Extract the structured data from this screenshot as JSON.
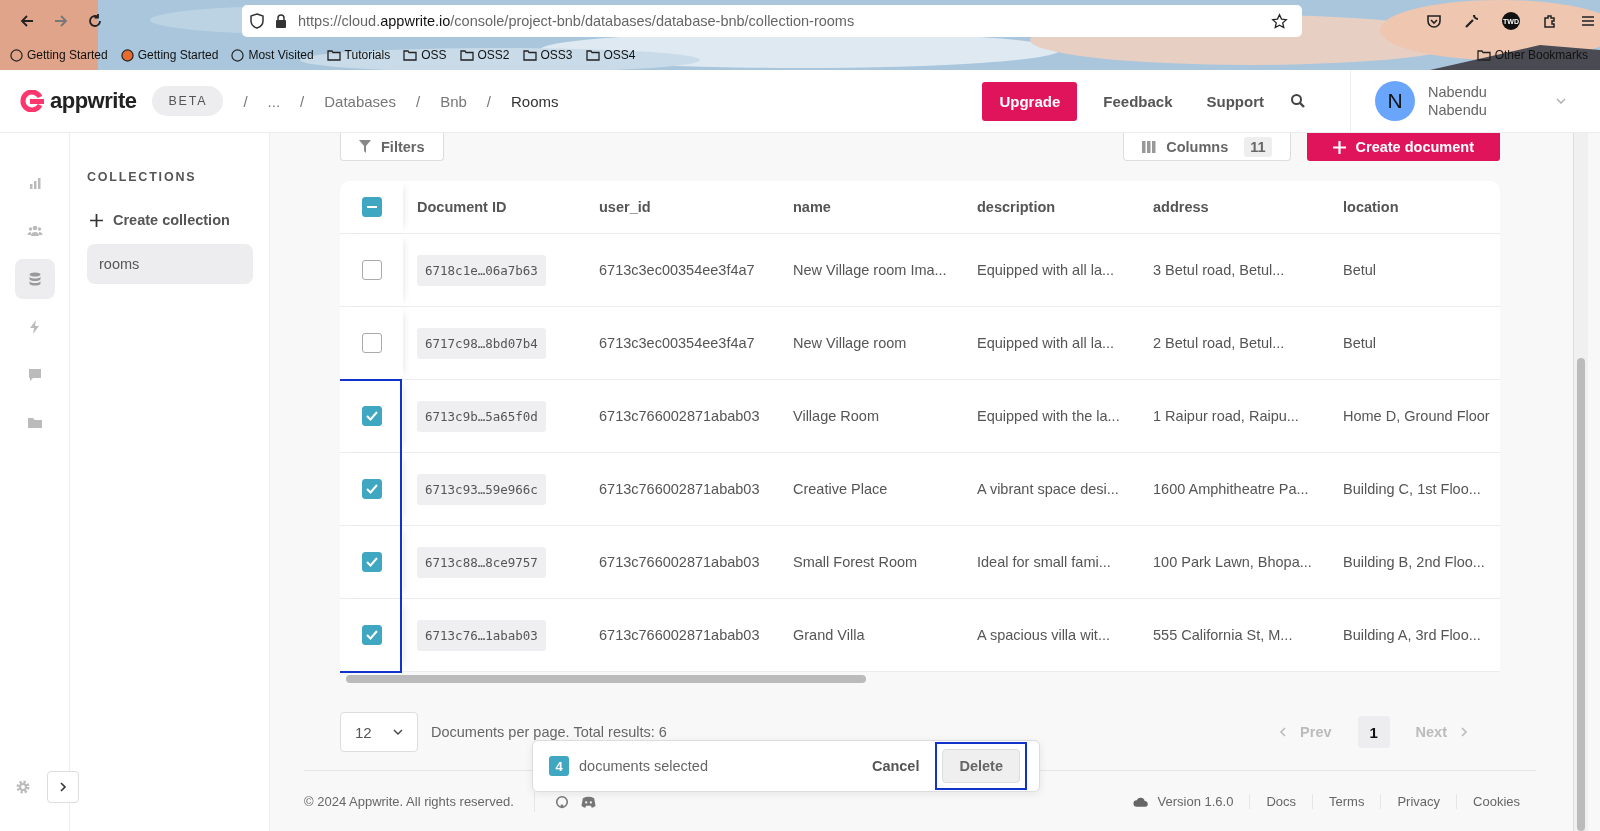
{
  "browser": {
    "url_host": "https://cloud.",
    "url_domain": "appwrite.io",
    "url_path": "/console/project-bnb/databases/database-bnb/collection-rooms",
    "profile": "TWD",
    "bookmarks": [
      "Getting Started",
      "Getting Started",
      "Most Visited",
      "Tutorials",
      "OSS",
      "OSS2",
      "OSS3",
      "OSS4"
    ],
    "other_bookmarks": "Other Bookmarks"
  },
  "header": {
    "logo": "appwrite",
    "badge": "BETA",
    "breadcrumbs": [
      "...",
      "Databases",
      "Bnb",
      "Rooms"
    ],
    "separator": "/",
    "upgrade": "Upgrade",
    "links": [
      "Feedback",
      "Support"
    ],
    "user": {
      "initial": "N",
      "name": "Nabendu",
      "email": "Nabendu"
    }
  },
  "rail": [
    {
      "kind": "chart",
      "selected": false
    },
    {
      "kind": "users",
      "selected": false
    },
    {
      "kind": "database",
      "selected": true
    },
    {
      "kind": "bolt",
      "selected": false
    },
    {
      "kind": "chat",
      "selected": false
    },
    {
      "kind": "folder",
      "selected": false
    }
  ],
  "sidebar": {
    "title": "COLLECTIONS",
    "create": "Create collection",
    "items": [
      {
        "label": "rooms",
        "selected": true
      }
    ]
  },
  "toolbar": {
    "filters": "Filters",
    "columns": "Columns",
    "columns_count": "11",
    "create": "Create document"
  },
  "table": {
    "header_indeterminate": true,
    "columns": [
      "Document ID",
      "user_id",
      "name",
      "description",
      "address",
      "location"
    ],
    "rows": [
      {
        "checked": false,
        "cells": [
          "6718c1e…06a7b63",
          "6713c3ec00354ee3f4a7",
          "New Village room Ima...",
          "Equipped with all la...",
          "3 Betul road, Betul...",
          "Betul"
        ]
      },
      {
        "checked": false,
        "cells": [
          "6717c98…8bd07b4",
          "6713c3ec00354ee3f4a7",
          "New Village room",
          "Equipped with all la...",
          "2 Betul road, Betul...",
          "Betul"
        ]
      },
      {
        "checked": true,
        "cells": [
          "6713c9b…5a65f0d",
          "6713c766002871abab03",
          "Village Room",
          "Equipped with the la...",
          "1 Raipur road, Raipu...",
          "Home D, Ground Floor"
        ]
      },
      {
        "checked": true,
        "cells": [
          "6713c93…59e966c",
          "6713c766002871abab03",
          "Creative Place",
          "A vibrant space desi...",
          "1600 Amphitheatre Pa...",
          "Building C, 1st Floo..."
        ]
      },
      {
        "checked": true,
        "cells": [
          "6713c88…8ce9757",
          "6713c766002871abab03",
          "Small Forest Room",
          "Ideal for small fami...",
          "100 Park Lawn, Bhopa...",
          "Building B, 2nd Floo..."
        ]
      },
      {
        "checked": true,
        "cells": [
          "6713c76…1abab03",
          "6713c766002871abab03",
          "Grand Villa",
          "A spacious villa wit...",
          "555 California St, M...",
          "Building A, 3rd Floo..."
        ]
      }
    ],
    "checkbox_frame": true
  },
  "pagination": {
    "per_page": "12",
    "summary": "Documents per page. Total results: 6",
    "prev": "Prev",
    "next": "Next",
    "prev_disabled": true,
    "next_disabled": true,
    "pages": [
      {
        "label": "1",
        "selected": true
      }
    ]
  },
  "selection_bar": {
    "count": "4",
    "text": "documents selected",
    "cancel": "Cancel",
    "delete": "Delete",
    "delete_frame": true
  },
  "footer": {
    "copyright": "© 2024 Appwrite. All rights reserved.",
    "version": "Version 1.6.0",
    "links": [
      "Docs",
      "Terms",
      "Privacy",
      "Cookies"
    ]
  }
}
